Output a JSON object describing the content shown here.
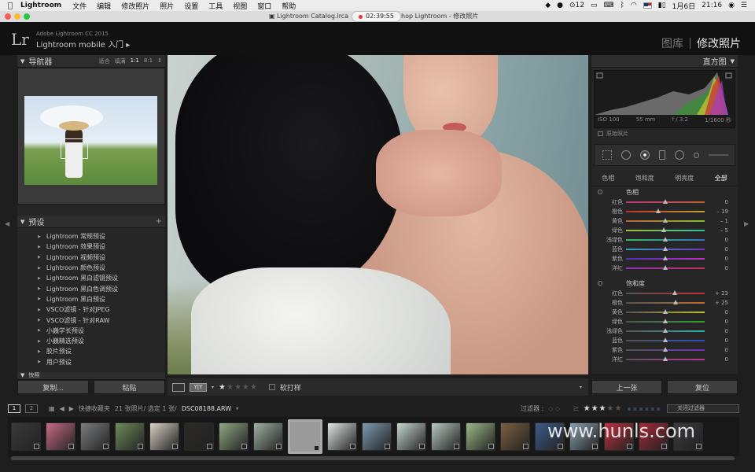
{
  "menubar": {
    "app": "Lightroom",
    "items": [
      "文件",
      "编辑",
      "修改照片",
      "照片",
      "设置",
      "工具",
      "视图",
      "窗口",
      "帮助"
    ],
    "status_num": "12",
    "date": "1月6日",
    "time": "21:16"
  },
  "titlebar": {
    "title_left": "Lightroom Catalog.lrca",
    "title_right": "hop Lightroom - 修改照片",
    "recording": "02:39:55"
  },
  "identity": {
    "logo": "Lr",
    "product": "Adobe Lightroom CC 2015",
    "mobile": "Lightroom mobile 入门 ▸",
    "modules": [
      "图库",
      "修改照片"
    ],
    "active_module": "修改照片"
  },
  "navigator": {
    "title": "导航器",
    "options": [
      "适合",
      "填满",
      "1:1",
      "8:1"
    ]
  },
  "presets": {
    "title": "预设",
    "add": "+",
    "items": [
      "Lightroom 常规预设",
      "Lightroom 效果预设",
      "Lightroom 视频预设",
      "Lightroom 颜色预设",
      "Lightroom 黑白滤镜预设",
      "Lightroom 黑白色调预设",
      "Lightroom 黑白预设",
      "VSCO滤镜 - 针对JPEG",
      "VSCO滤镜 - 针对RAW",
      "小巍学长预设",
      "小巍精选预设",
      "胶片预设",
      "用户预设"
    ],
    "next_panel": "快照"
  },
  "left_buttons": {
    "copy": "复制...",
    "paste": "粘贴"
  },
  "toolbar": {
    "yy": "Y|Y",
    "softproof": "软打样",
    "rating": 1
  },
  "histogram": {
    "title": "直方图",
    "iso": "ISO 100",
    "focal": "55 mm",
    "aperture": "f / 3.2",
    "shutter": "1/1600 秒",
    "original": "原始照片"
  },
  "hsl": {
    "tabs": [
      "色相",
      "饱和度",
      "明亮度",
      "全部"
    ],
    "active_tab": "全部",
    "hue_title": "色相",
    "sat_title": "饱和度",
    "hue": [
      {
        "label": "红色",
        "value": "0",
        "pos": 0.5
      },
      {
        "label": "橙色",
        "value": "– 19",
        "pos": 0.41
      },
      {
        "label": "黄色",
        "value": "– 1",
        "pos": 0.5
      },
      {
        "label": "绿色",
        "value": "– 5",
        "pos": 0.48
      },
      {
        "label": "浅绿色",
        "value": "0",
        "pos": 0.5
      },
      {
        "label": "蓝色",
        "value": "0",
        "pos": 0.5
      },
      {
        "label": "紫色",
        "value": "0",
        "pos": 0.5
      },
      {
        "label": "洋红",
        "value": "0",
        "pos": 0.5
      }
    ],
    "sat": [
      {
        "label": "红色",
        "value": "+ 23",
        "pos": 0.62
      },
      {
        "label": "橙色",
        "value": "+ 25",
        "pos": 0.63
      },
      {
        "label": "黄色",
        "value": "0",
        "pos": 0.5
      },
      {
        "label": "绿色",
        "value": "0",
        "pos": 0.5
      },
      {
        "label": "浅绿色",
        "value": "0",
        "pos": 0.5
      },
      {
        "label": "蓝色",
        "value": "0",
        "pos": 0.5
      },
      {
        "label": "紫色",
        "value": "0",
        "pos": 0.5
      },
      {
        "label": "洋红",
        "value": "0",
        "pos": 0.5
      }
    ]
  },
  "right_buttons": {
    "prev": "上一张",
    "reset": "复位"
  },
  "filmstrip": {
    "page1": "1",
    "page2": "2",
    "source": "快捷收藏夹",
    "count": "21 张照片/ 选定 1 张/",
    "filename": "DSC08188.ARW",
    "filter_label": "过滤器 :",
    "filter_off": "关闭过滤器",
    "thumbs": [
      "#3a3a3a",
      "#c96a86",
      "#7a7e80",
      "#6e8a5a",
      "#d8d0c2",
      "#2b2a24",
      "#8ea884",
      "#9fb0a0",
      "#e8ecef",
      "#dfe6e2",
      "#7f9ab0",
      "#c7d6cf",
      "#b8c8c0",
      "#9cb888",
      "#7a6040",
      "#3c5c8a",
      "#8aa0b0",
      "#c03040",
      "#a82838",
      "#3a3a40"
    ],
    "selected_index": 8
  },
  "watermark": "www.hunls.com",
  "colors": {
    "accent": "#e8e8e8",
    "panel": "#262626",
    "bg": "#1e1e1e"
  }
}
